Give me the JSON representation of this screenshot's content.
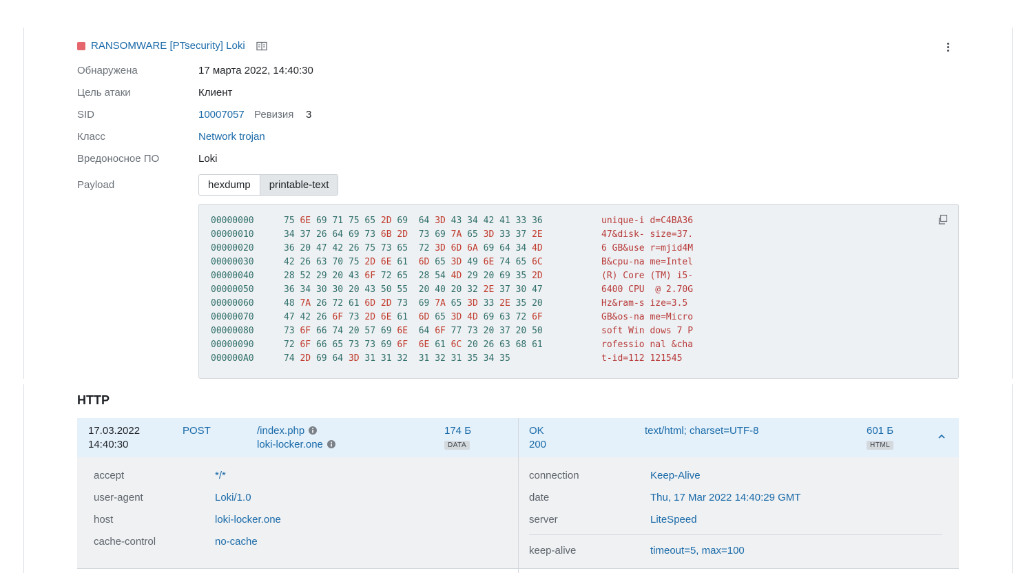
{
  "alert": {
    "title": "RANSOMWARE [PTsecurity] Loki",
    "status_color": "#e5666d",
    "icons": [
      "rule-book-icon",
      "more-vertical-icon"
    ]
  },
  "properties": {
    "detected_label": "Обнаружена",
    "detected_value": "17 марта 2022, 14:40:30",
    "target_label": "Цель атаки",
    "target_value": "Клиент",
    "sid_label": "SID",
    "sid_value": "10007057",
    "revision_label": "Ревизия",
    "revision_value": "3",
    "class_label": "Класс",
    "class_value": "Network trojan",
    "malware_label": "Вредоносное ПО",
    "malware_value": "Loki",
    "payload_label": "Payload"
  },
  "payload": {
    "tabs": [
      "hexdump",
      "printable-text"
    ],
    "active_tab": "hexdump",
    "rows": [
      {
        "offset": "00000000",
        "hex": "75 6E 69 71 75 65 2D 69  64 3D 43 34 42 41 33 36",
        "text": "unique-i d=C4BA36"
      },
      {
        "offset": "00000010",
        "hex": "34 37 26 64 69 73 6B 2D  73 69 7A 65 3D 33 37 2E",
        "text": "47&disk- size=37."
      },
      {
        "offset": "00000020",
        "hex": "36 20 47 42 26 75 73 65  72 3D 6D 6A 69 64 34 4D",
        "text": "6 GB&use r=mjid4M"
      },
      {
        "offset": "00000030",
        "hex": "42 26 63 70 75 2D 6E 61  6D 65 3D 49 6E 74 65 6C",
        "text": "B&cpu-na me=Intel"
      },
      {
        "offset": "00000040",
        "hex": "28 52 29 20 43 6F 72 65  28 54 4D 29 20 69 35 2D",
        "text": "(R) Core (TM) i5-"
      },
      {
        "offset": "00000050",
        "hex": "36 34 30 30 20 43 50 55  20 40 20 32 2E 37 30 47",
        "text": "6400 CPU  @ 2.70G"
      },
      {
        "offset": "00000060",
        "hex": "48 7A 26 72 61 6D 2D 73  69 7A 65 3D 33 2E 35 20",
        "text": "Hz&ram-s ize=3.5"
      },
      {
        "offset": "00000070",
        "hex": "47 42 26 6F 73 2D 6E 61  6D 65 3D 4D 69 63 72 6F",
        "text": "GB&os-na me=Micro"
      },
      {
        "offset": "00000080",
        "hex": "73 6F 66 74 20 57 69 6E  64 6F 77 73 20 37 20 50",
        "text": "soft Win dows 7 P"
      },
      {
        "offset": "00000090",
        "hex": "72 6F 66 65 73 73 69 6F  6E 61 6C 20 26 63 68 61",
        "text": "rofessio nal &cha"
      },
      {
        "offset": "000000A0",
        "hex": "74 2D 69 64 3D 31 31 32  31 32 31 35 34 35",
        "text": "t-id=112 121545"
      }
    ]
  },
  "http": {
    "section_title": "HTTP",
    "request": {
      "date": "17.03.2022",
      "time": "14:40:30",
      "method": "POST",
      "path": "/index.php",
      "host": "loki-locker.one",
      "size": "174 Б",
      "size_badge": "DATA",
      "headers": [
        {
          "key": "accept",
          "value": "*/*"
        },
        {
          "key": "user-agent",
          "value": "Loki/1.0"
        },
        {
          "key": "host",
          "value": "loki-locker.one"
        },
        {
          "key": "cache-control",
          "value": "no-cache"
        }
      ]
    },
    "response": {
      "status_text": "OK",
      "status_code": "200",
      "content_type": "text/html; charset=UTF-8",
      "size": "601 Б",
      "size_badge": "HTML",
      "headers": [
        {
          "key": "connection",
          "value": "Keep-Alive"
        },
        {
          "key": "date",
          "value": "Thu, 17 Mar 2022 14:40:29 GMT"
        },
        {
          "key": "server",
          "value": "LiteSpeed"
        },
        {
          "key": "keep-alive",
          "value": "timeout=5, max=100"
        }
      ]
    }
  }
}
